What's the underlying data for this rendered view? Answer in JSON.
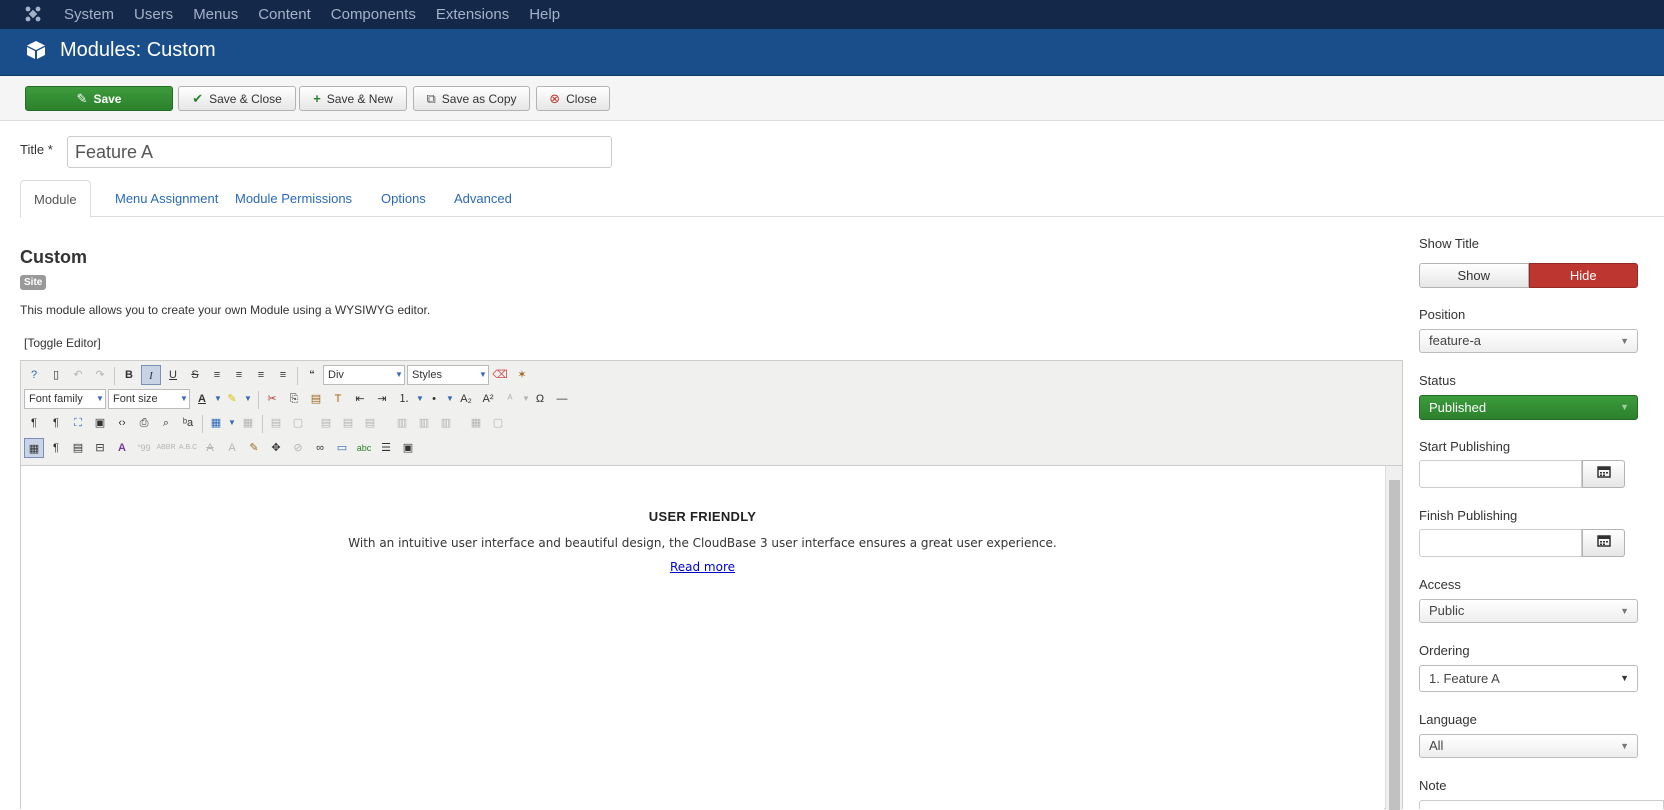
{
  "topnav": {
    "items": [
      "System",
      "Users",
      "Menus",
      "Content",
      "Components",
      "Extensions",
      "Help"
    ]
  },
  "header": {
    "title": "Modules: Custom"
  },
  "toolbar": {
    "save": "Save",
    "save_close": "Save & Close",
    "save_new": "Save & New",
    "save_copy": "Save as Copy",
    "close": "Close"
  },
  "form": {
    "title_label": "Title *",
    "title_value": "Feature A"
  },
  "tabs": [
    "Module",
    "Menu Assignment",
    "Module Permissions",
    "Options",
    "Advanced"
  ],
  "module": {
    "heading": "Custom",
    "badge": "Site",
    "description": "This module allows you to create your own Module using a WYSIWYG editor.",
    "toggle": "[Toggle Editor]"
  },
  "editor": {
    "format_select": "Div",
    "styles_select": "Styles",
    "font_family": "Font family",
    "font_size": "Font size",
    "content_heading": "USER FRIENDLY",
    "content_text": "With an intuitive user interface and beautiful design, the CloudBase 3 user interface ensures a great user experience.",
    "content_link": "Read more"
  },
  "sidebar": {
    "show_title_label": "Show Title",
    "show": "Show",
    "hide": "Hide",
    "position_label": "Position",
    "position_value": "feature-a",
    "status_label": "Status",
    "status_value": "Published",
    "start_label": "Start Publishing",
    "finish_label": "Finish Publishing",
    "access_label": "Access",
    "access_value": "Public",
    "ordering_label": "Ordering",
    "ordering_value": "1. Feature A",
    "language_label": "Language",
    "language_value": "All",
    "note_label": "Note"
  },
  "colors": {
    "topnav": "#14294a",
    "header": "#1a4e8a",
    "save": "#2c812c",
    "hide": "#bd362f",
    "link": "#2a69b8"
  }
}
